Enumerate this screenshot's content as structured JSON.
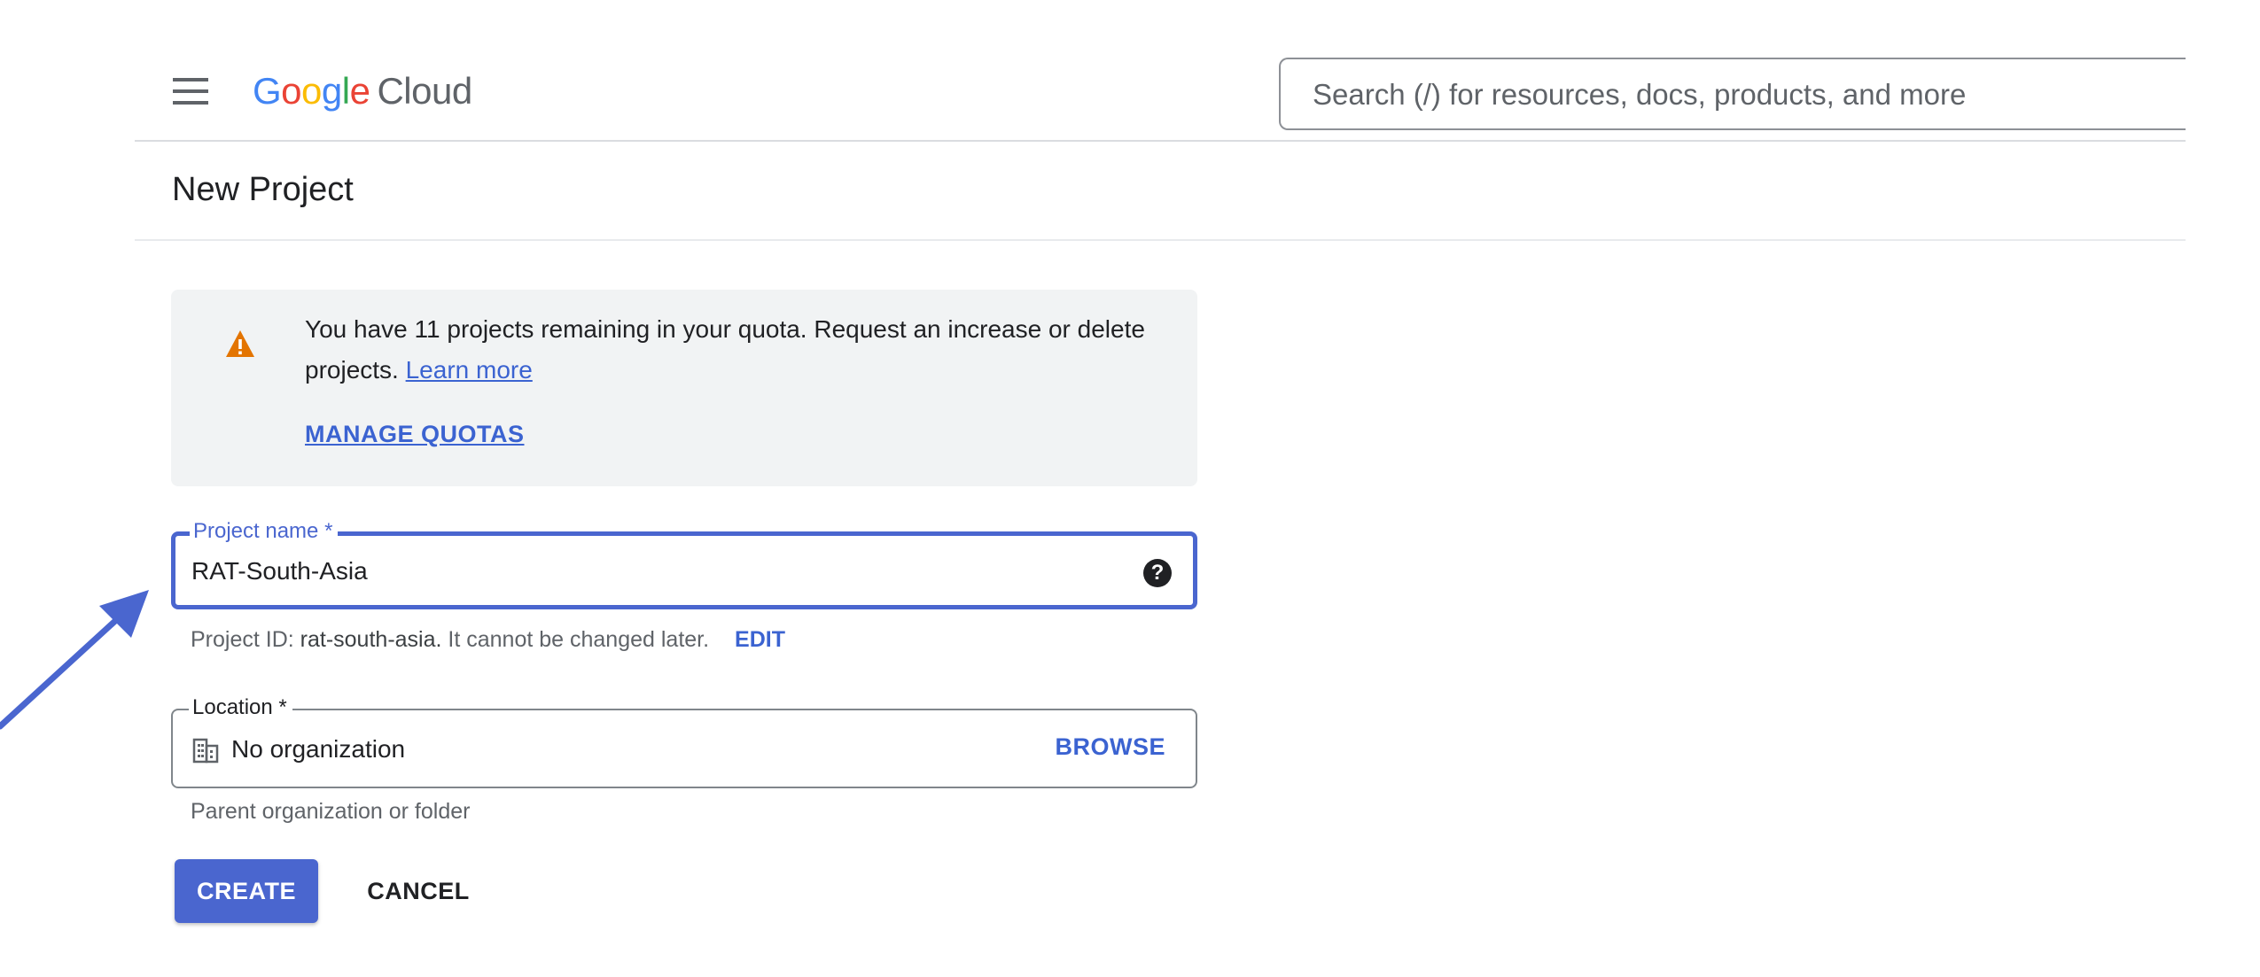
{
  "header": {
    "logo": {
      "g1": "G",
      "o1": "o",
      "o2": "o",
      "g2": "g",
      "l": "l",
      "e": "e",
      "product": "Cloud"
    },
    "search_placeholder": "Search (/) for resources, docs, products, and more"
  },
  "page": {
    "title": "New Project"
  },
  "notice": {
    "text": "You have 11 projects remaining in your quota. Request an increase or delete projects.",
    "learn_more": "Learn more",
    "manage_quotas": "MANAGE QUOTAS"
  },
  "form": {
    "project_name": {
      "label": "Project name *",
      "value": "RAT-South-Asia",
      "help_icon": "?"
    },
    "project_id": {
      "prefix": "Project ID:",
      "value": "rat-south-asia.",
      "suffix": "It cannot be changed later.",
      "edit": "EDIT"
    },
    "location": {
      "label": "Location *",
      "value": "No organization",
      "browse": "BROWSE",
      "helper": "Parent organization or folder"
    }
  },
  "actions": {
    "create": "CREATE",
    "cancel": "CANCEL"
  },
  "icons": {
    "menu": "hamburger-menu-icon",
    "warning": "warning-triangle-icon",
    "help": "help-circle-icon",
    "building": "building-icon",
    "annotation": "arrow-annotation"
  },
  "colors": {
    "accent": "#4a66cf",
    "link": "#3b63d1",
    "warning": "#e37400",
    "notice_bg": "#f1f3f4"
  }
}
